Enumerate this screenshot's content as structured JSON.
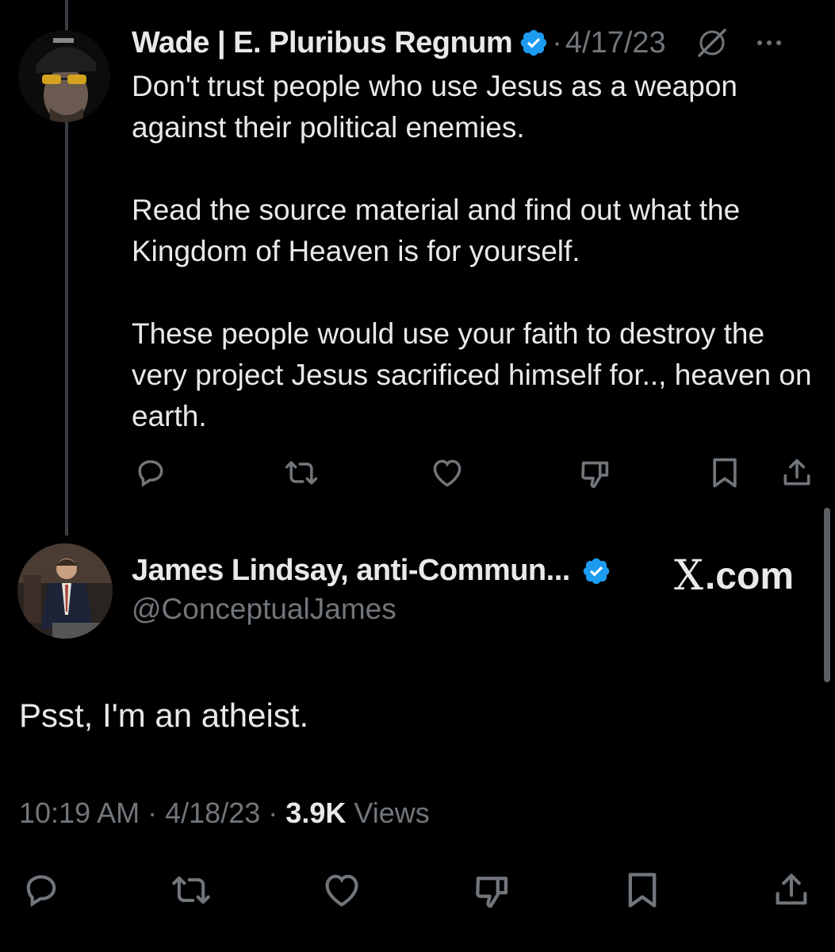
{
  "reply": {
    "author_name": "Wade | E. Pluribus Regnum",
    "date": "4/17/23",
    "paragraphs": [
      "Don't trust people who use Jesus as a weapon against their political enemies.",
      "Read the source material and find out what the Kingdom of Heaven is for yourself.",
      "These people would use your faith to destroy the very project Jesus sacrificed himself for.., heaven on earth."
    ]
  },
  "main_tweet": {
    "author_name": "James Lindsay, anti-Commun...",
    "handle": "@ConceptualJames",
    "text": "Psst, I'm an atheist.",
    "time": "10:19 AM",
    "date": "4/18/23",
    "views_count": "3.9K",
    "views_label": "Views"
  },
  "watermark": {
    "x_glyph": "X",
    "text": ".com"
  },
  "meta": {
    "separator": "·"
  },
  "colors": {
    "background": "#000000",
    "text": "#e7e9ea",
    "muted": "#71767b",
    "verified": "#1d9bf0",
    "thread_line": "#3a3d41"
  },
  "icons": {
    "actions": [
      "reply-icon",
      "repost-icon",
      "like-icon",
      "dislike-icon",
      "bookmark-icon",
      "share-icon"
    ],
    "header": [
      "verified-badge-icon",
      "grok-icon",
      "more-icon"
    ]
  }
}
